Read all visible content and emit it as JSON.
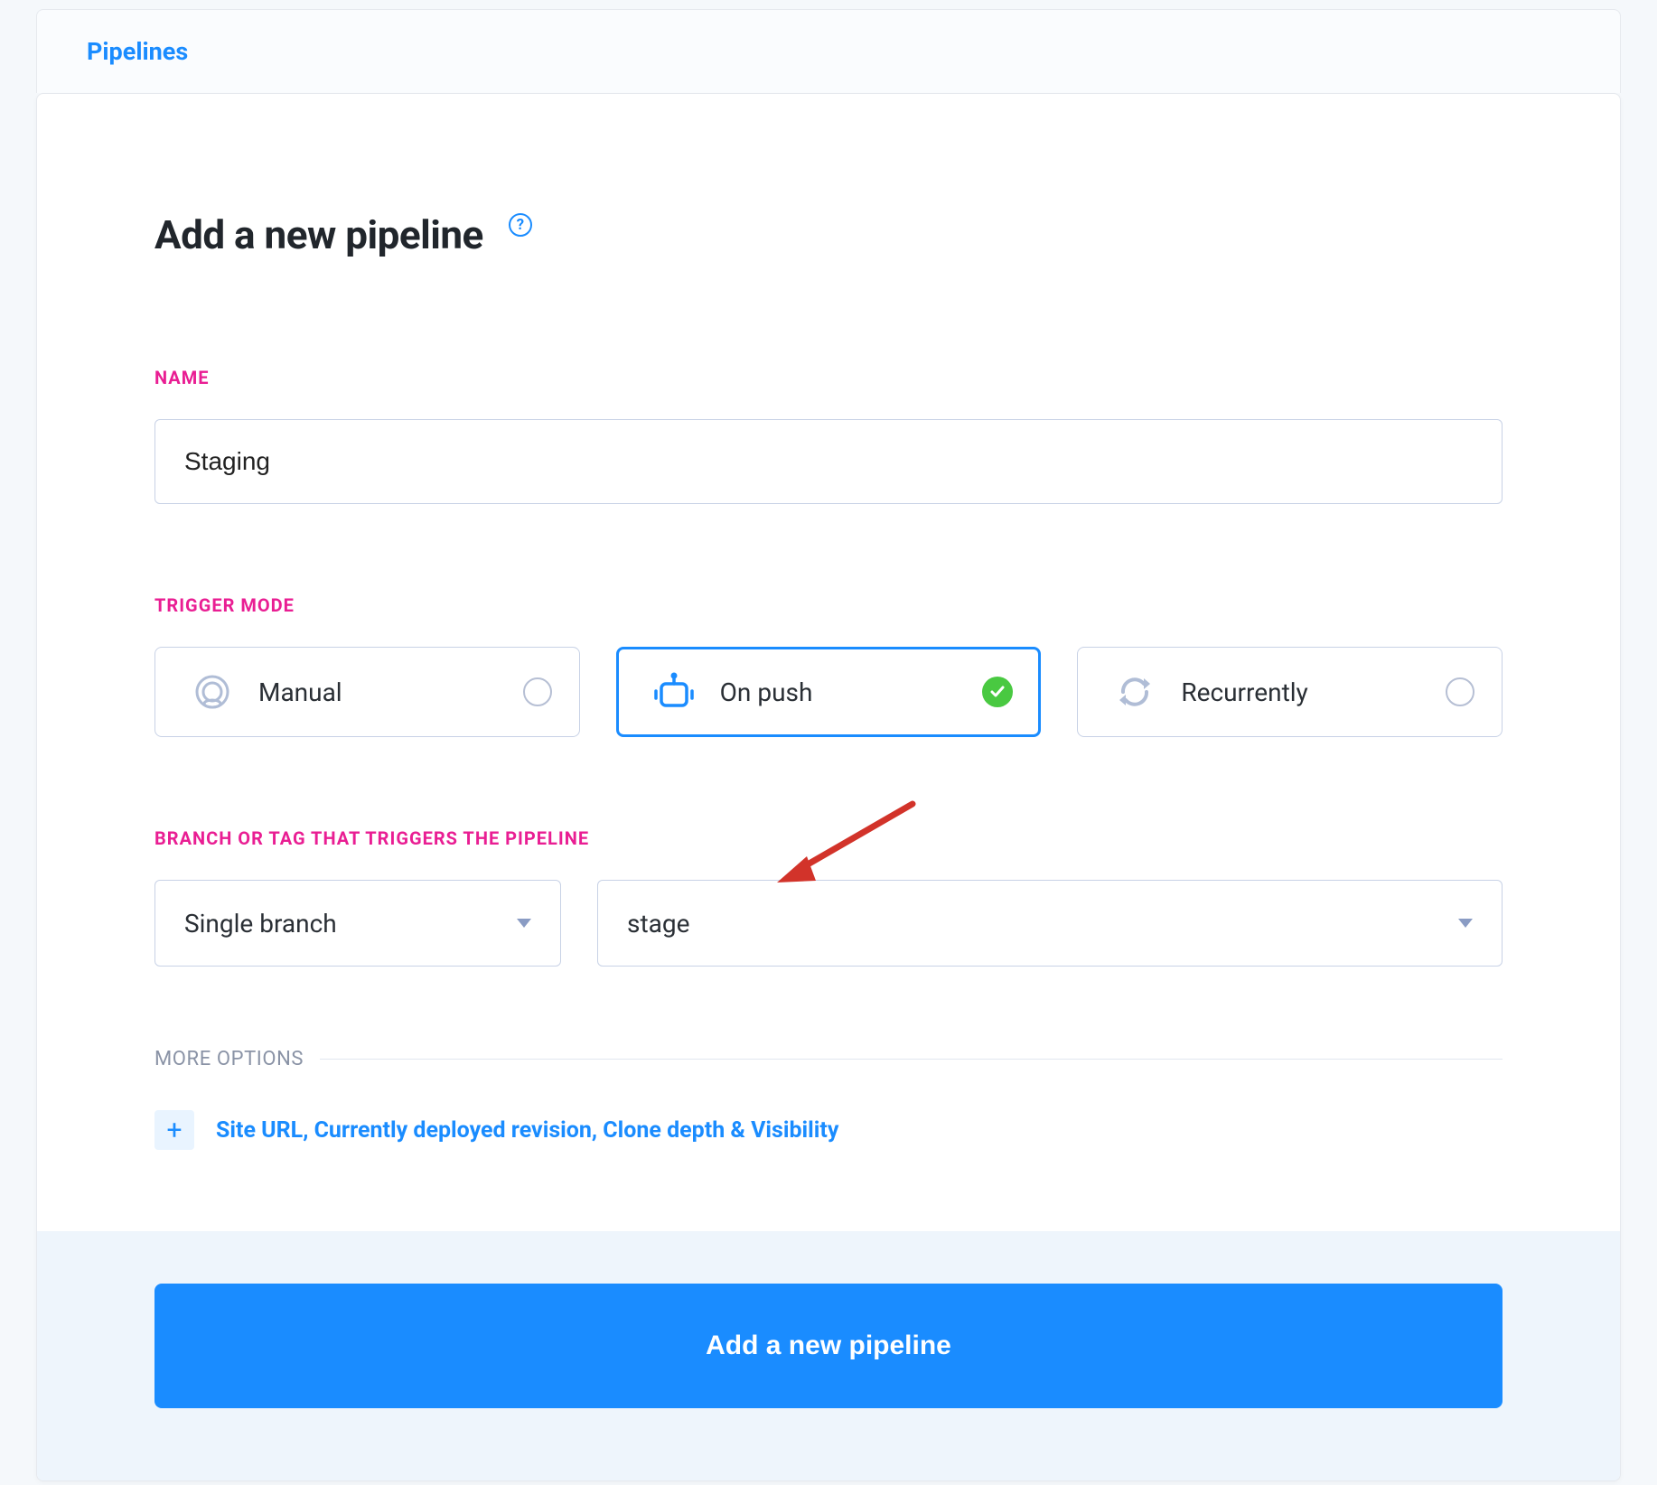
{
  "breadcrumb": {
    "label": "Pipelines"
  },
  "title": "Add a new pipeline",
  "name_section": {
    "label": "NAME",
    "value": "Staging"
  },
  "trigger_section": {
    "label": "TRIGGER MODE",
    "options": [
      {
        "label": "Manual",
        "icon": "hand-icon"
      },
      {
        "label": "On push",
        "icon": "robot-icon"
      },
      {
        "label": "Recurrently",
        "icon": "cycle-icon"
      }
    ],
    "selected_index": 1
  },
  "branch_section": {
    "label": "BRANCH OR TAG THAT TRIGGERS THE PIPELINE",
    "scope": "Single branch",
    "value": "stage"
  },
  "more_options": {
    "label": "MORE OPTIONS",
    "expand_label": "Site URL, Currently deployed revision, Clone depth & Visibility"
  },
  "submit": {
    "label": "Add a new pipeline"
  }
}
